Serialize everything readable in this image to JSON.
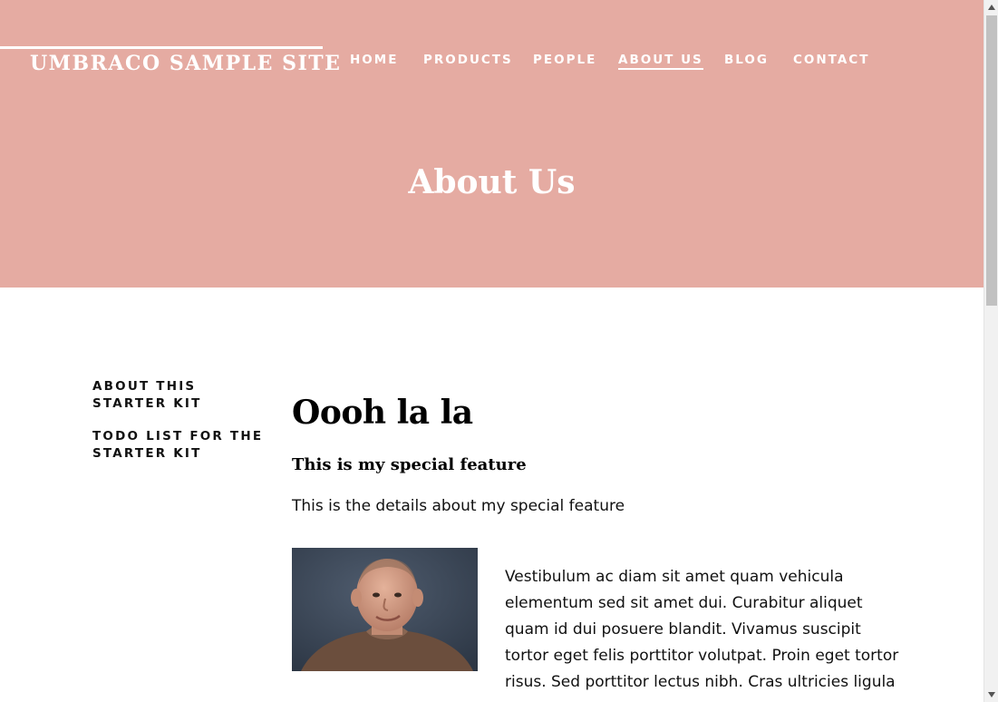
{
  "header": {
    "brand": "UMBRACO SAMPLE SITE",
    "nav": [
      {
        "label": "HOME",
        "active": false
      },
      {
        "label": "PRODUCTS",
        "active": false
      },
      {
        "label": "PEOPLE",
        "active": false
      },
      {
        "label": "ABOUT US",
        "active": true
      },
      {
        "label": "BLOG",
        "active": false
      },
      {
        "label": "CONTACT",
        "active": false
      }
    ],
    "page_title": "About Us",
    "background_color": "#e5aba2"
  },
  "sidebar": {
    "items": [
      {
        "label": "ABOUT THIS STARTER KIT"
      },
      {
        "label": "TODO LIST FOR THE STARTER KIT"
      }
    ]
  },
  "main": {
    "heading": "Oooh la la",
    "subheading": "This is my special feature",
    "intro": "This is the details about my special feature",
    "body": "Vestibulum ac diam sit amet quam vehicula elementum sed sit amet dui. Curabitur aliquet quam id dui posuere blandit. Vivamus suscipit tortor eget felis porttitor volutpat. Proin eget tortor risus. Sed porttitor lectus nibh. Cras ultricies ligula"
  },
  "icons": {
    "scroll_up": "triangle-up-icon",
    "scroll_down": "triangle-down-icon"
  }
}
